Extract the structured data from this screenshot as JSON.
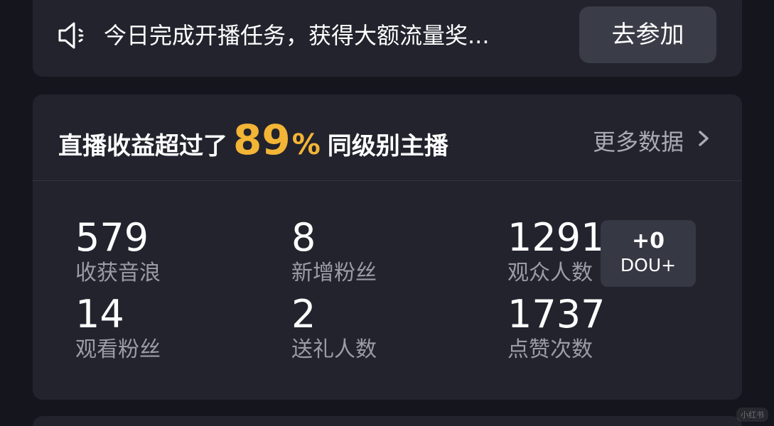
{
  "notice": {
    "icon": "speaker-icon",
    "text": "今日完成开播任务，获得大额流量奖...",
    "button_label": "去参加"
  },
  "summary": {
    "prefix": "直播收益超过了",
    "percent_number": "89",
    "percent_sign": "%",
    "suffix": "同级别主播",
    "more_label": "更多数据",
    "more_icon": "chevron-right-icon"
  },
  "stats": [
    {
      "value": "579",
      "label": "收获音浪"
    },
    {
      "value": "8",
      "label": "新增粉丝"
    },
    {
      "value": "1291",
      "label": "观众人数"
    },
    {
      "value": "14",
      "label": "观看粉丝"
    },
    {
      "value": "2",
      "label": "送礼人数"
    },
    {
      "value": "1737",
      "label": "点赞次数"
    }
  ],
  "dou_badge": {
    "count": "+0",
    "label": "DOU+"
  },
  "watermark": "小红书",
  "colors": {
    "background": "#15151d",
    "card": "#22232d",
    "accent": "#f3b536",
    "muted_text": "#9a9ca6",
    "button": "#3a3c47"
  }
}
